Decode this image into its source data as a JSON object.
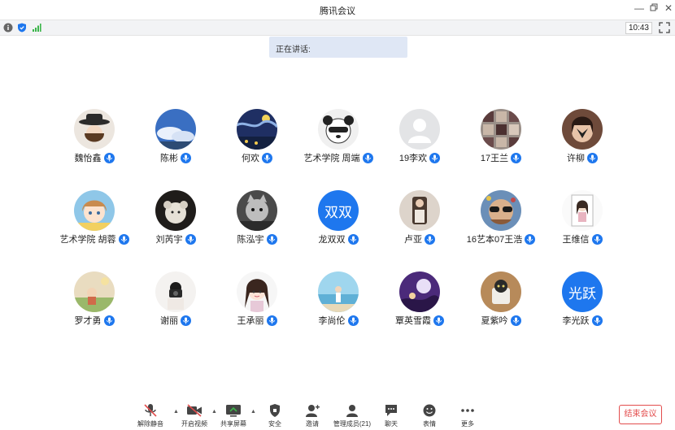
{
  "window": {
    "title": "腾讯会议"
  },
  "status": {
    "time": "10:43"
  },
  "speaking": {
    "label": "正在讲话:"
  },
  "participants": [
    {
      "name": "魏怡鑫",
      "avatar": "photo-hat"
    },
    {
      "name": "陈彬",
      "avatar": "photo-sky"
    },
    {
      "name": "何欢",
      "avatar": "photo-starry-night"
    },
    {
      "name": "艺术学院 周端",
      "avatar": "photo-panda"
    },
    {
      "name": "19李欢",
      "avatar": "default-user"
    },
    {
      "name": "17王兰",
      "avatar": "photo-grid"
    },
    {
      "name": "许柳",
      "avatar": "photo-butterfly-girl"
    },
    {
      "name": "艺术学院 胡蓉",
      "avatar": "photo-anime-girl"
    },
    {
      "name": "刘芮宇",
      "avatar": "photo-dog-plush"
    },
    {
      "name": "陈泓宇",
      "avatar": "photo-monochrome-cat"
    },
    {
      "name": "龙双双",
      "avatar": "text",
      "avatar_text": "双双"
    },
    {
      "name": "卢亚",
      "avatar": "photo-mirror-selfie"
    },
    {
      "name": "16艺本07王浩",
      "avatar": "photo-sunglasses"
    },
    {
      "name": "王维信",
      "avatar": "photo-sketch-girl"
    },
    {
      "name": "罗才勇",
      "avatar": "photo-illustration"
    },
    {
      "name": "谢丽",
      "avatar": "photo-camera-girl"
    },
    {
      "name": "王承丽",
      "avatar": "photo-cartoon-girl"
    },
    {
      "name": "李尚伦",
      "avatar": "photo-beach"
    },
    {
      "name": "覃英雪霞",
      "avatar": "photo-purple-moon"
    },
    {
      "name": "夏紫吟",
      "avatar": "photo-cat-cup"
    },
    {
      "name": "李光跃",
      "avatar": "text",
      "avatar_text": "光跃"
    }
  ],
  "toolbar": {
    "mute": "解除静音",
    "video": "开启视频",
    "share": "共享屏幕",
    "security": "安全",
    "invite": "邀请",
    "members": "管理成员(21)",
    "chat": "聊天",
    "emoji": "表情",
    "more": "更多",
    "end": "结束会议"
  },
  "colors": {
    "accent": "#1e77ee",
    "end": "#e34d4d",
    "speaking_bg": "#dfe7f5"
  }
}
